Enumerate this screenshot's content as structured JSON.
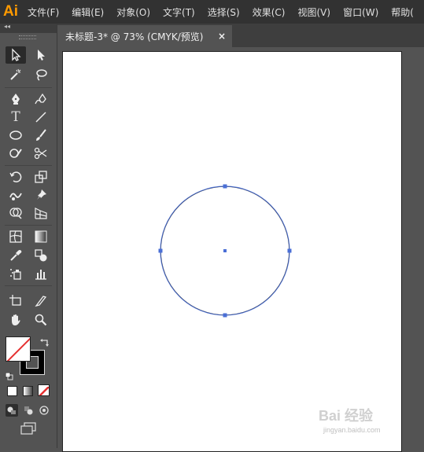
{
  "app": {
    "logo_text": "Ai",
    "accent": "#ff9a00"
  },
  "menubar": {
    "items": [
      "文件(F)",
      "编辑(E)",
      "对象(O)",
      "文字(T)",
      "选择(S)",
      "效果(C)",
      "视图(V)",
      "窗口(W)",
      "帮助("
    ]
  },
  "toolbar": {
    "collapse_label": "◂◂",
    "type_tool_label": "T",
    "tools": [
      "selection-tool",
      "direct-selection-tool",
      "magic-wand-tool",
      "lasso-tool",
      "pen-tool",
      "curvature-tool",
      "type-tool",
      "line-segment-tool",
      "ellipse-tool",
      "paintbrush-tool",
      "shaper-tool",
      "scissors-tool",
      "rotate-tool",
      "scale-tool",
      "warp-tool",
      "puppet-warp-tool",
      "shape-builder-tool",
      "perspective-grid-tool",
      "mesh-tool",
      "gradient-tool",
      "eyedropper-tool",
      "blend-tool",
      "symbol-sprayer-tool",
      "column-graph-tool",
      "artboard-tool",
      "slice-tool",
      "hand-tool",
      "zoom-tool"
    ],
    "fill_color": "none",
    "stroke_color": "#000000"
  },
  "document": {
    "tab_title": "未标题-3* @ 73% (CMYK/预览)",
    "close_glyph": "×"
  },
  "canvas": {
    "shape": "ellipse",
    "selection_color": "#4a6fd6"
  },
  "watermark": {
    "brand": "Bai 经验",
    "url": "jingyan.baidu.com"
  }
}
